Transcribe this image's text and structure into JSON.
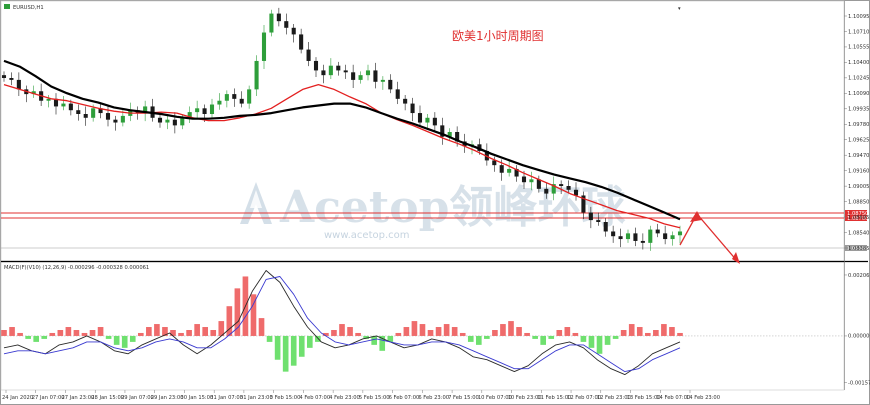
{
  "window": {
    "title": "EURUSD,H1"
  },
  "annotation": {
    "text": "欧美1小时周期图",
    "color": "#e03030"
  },
  "watermark": {
    "brand": "Acetop领峰环球",
    "url": "www.acetop.com",
    "color": "#b8c9d8"
  },
  "indicator_header": "MACD(F)(V10) (12,26,9) -0.000296 -0.000328 0.000061",
  "colors": {
    "bull": "#2e9e3a",
    "bear": "#1a1a1a",
    "ma_fast": "#e32020",
    "ma_slow": "#000000",
    "hist_pos": "#ef6b6b",
    "hist_neg": "#6fe06f",
    "macd_line": "#2a2a2a",
    "signal_line": "#3a3ad0",
    "level_line": "#e03030",
    "grid_sep": "#000000"
  },
  "chart_data": [
    {
      "type": "line",
      "name": "price-panel",
      "title": "EURUSD,H1",
      "y_ticks": [
        "1.10095",
        "1.10710",
        "1.10555",
        "1.10400",
        "1.10245",
        "1.10090",
        "1.09935",
        "1.09780",
        "1.09625",
        "1.09470",
        "1.09160",
        "1.09005",
        "1.08850",
        "1.08695",
        "1.08540",
        "1.08385"
      ],
      "ylim": [
        1.0832,
        1.1098
      ],
      "levels": [
        {
          "price": 1.0875,
          "label": "1.08750"
        },
        {
          "price": 1.0866,
          "label": "1.08700"
        },
        {
          "price": 1.0838,
          "label": "1.08385"
        }
      ],
      "series": [
        {
          "name": "",
          "values": [
            1.1015,
            1.101,
            1.1005,
            1.1,
            1.0998,
            1.0994,
            1.099,
            1.0987,
            1.0985,
            1.0985,
            1.0986,
            1.0985,
            1.098,
            1.0977,
            1.0977,
            1.098,
            1.0984,
            1.099,
            1.1,
            1.101,
            1.1015,
            1.101,
            1.1002,
            1.0995,
            1.0985,
            1.0978,
            1.0972,
            1.0965,
            1.0958,
            1.0952,
            1.0945,
            1.0937,
            1.093,
            1.0922,
            1.0915,
            1.0908,
            1.09,
            1.0894,
            1.0888,
            1.0882,
            1.0878,
            1.0874,
            1.0868,
            1.0864
          ]
        },
        {
          "name": "",
          "values": [
            1.104,
            1.1034,
            1.1024,
            1.1013,
            1.1006,
            1.1,
            1.0996,
            1.0991,
            1.0988,
            1.0986,
            1.0984,
            1.0981,
            1.0979,
            1.0979,
            1.098,
            1.0982,
            1.0983,
            1.0985,
            1.0988,
            1.0991,
            1.0993,
            1.0995,
            1.0995,
            1.0991,
            1.0985,
            1.0979,
            1.0974,
            1.0968,
            1.0962,
            1.0955,
            1.0949,
            1.0942,
            1.0936,
            1.093,
            1.0925,
            1.092,
            1.0916,
            1.0912,
            1.0907,
            1.0901,
            1.0894,
            1.0887,
            1.088,
            1.0873
          ]
        }
      ],
      "candles": [
        1.1022,
        1.102,
        1.101,
        1.1005,
        1.1008,
        1.0998,
        1.1,
        1.0992,
        1.0995,
        1.0988,
        1.0984,
        1.098,
        1.099,
        1.0985,
        1.0978,
        1.0975,
        1.0982,
        1.0988,
        1.0985,
        1.0992,
        1.098,
        1.0975,
        1.0978,
        1.0972,
        1.098,
        1.0986,
        1.099,
        1.0984,
        1.0994,
        1.0998,
        1.1005,
        1.1,
        1.0995,
        1.101,
        1.104,
        1.107,
        1.109,
        1.1082,
        1.1075,
        1.1068,
        1.1052,
        1.104,
        1.103,
        1.1025,
        1.1035,
        1.103,
        1.1028,
        1.102,
        1.1025,
        1.103,
        1.1018,
        1.102,
        1.101,
        1.1,
        1.0995,
        1.0985,
        1.0975,
        1.098,
        1.0972,
        1.096,
        1.0965,
        1.0955,
        1.095,
        1.0952,
        1.0945,
        1.0935,
        1.093,
        1.0922,
        1.0926,
        1.0918,
        1.0912,
        1.0915,
        1.0905,
        1.09,
        1.091,
        1.0908,
        1.0904,
        1.0898,
        1.088,
        1.0872,
        1.087,
        1.086,
        1.0855,
        1.0852,
        1.0858,
        1.085,
        1.0848,
        1.0862,
        1.0858,
        1.0852,
        1.0856,
        1.086
      ]
    },
    {
      "type": "bar",
      "name": "macd-panel",
      "y_ticks": [
        "0.002067",
        "0.000000",
        "-0.001572"
      ],
      "ylim": [
        -0.00175,
        0.00215
      ],
      "histogram": [
        0.0002,
        0.0003,
        0.0001,
        -0.0001,
        -0.0002,
        -0.0001,
        0.0001,
        0.0002,
        0.0003,
        0.0002,
        0.0001,
        0.0002,
        0.0003,
        -0.0001,
        -0.0003,
        -0.0004,
        -0.0002,
        0.0001,
        0.0003,
        0.0004,
        0.0003,
        0.0002,
        0.0001,
        0.0002,
        0.0004,
        0.0003,
        0.0002,
        0.0005,
        0.001,
        0.0016,
        0.002,
        0.0014,
        0.0006,
        -0.0002,
        -0.0008,
        -0.0012,
        -0.001,
        -0.0007,
        -0.0004,
        -0.0002,
        0.0001,
        0.0002,
        0.0004,
        0.0003,
        0.0001,
        -0.0001,
        -0.0003,
        -0.0005,
        -0.0002,
        0.0001,
        0.0003,
        0.0005,
        0.0004,
        0.0002,
        0.0003,
        0.0004,
        0.0003,
        0.0001,
        -0.0002,
        -0.0003,
        -0.0001,
        0.0002,
        0.0004,
        0.0005,
        0.0003,
        0.0001,
        -0.0001,
        -0.0003,
        -0.0001,
        0.0002,
        0.0003,
        0.0001,
        -0.0002,
        -0.0004,
        -0.0006,
        -0.0003,
        -0.0001,
        0.0002,
        0.0004,
        0.0003,
        0.0001,
        0.0002,
        0.0004,
        0.0003,
        0.0001
      ],
      "series": [
        {
          "name": "",
          "values": [
            -0.0004,
            -0.0003,
            -0.0005,
            -0.0006,
            -0.0003,
            -0.0002,
            0.0,
            -0.0002,
            -0.0005,
            -0.0006,
            -0.0003,
            -0.0001,
            0.0001,
            -0.0003,
            -0.0006,
            -0.0003,
            0.0001,
            0.0005,
            0.0015,
            0.0022,
            0.0018,
            0.001,
            0.0003,
            -0.0002,
            -0.0004,
            -0.0003,
            -0.0001,
            0.0,
            -0.0002,
            -0.0004,
            -0.0003,
            -0.0001,
            -0.0002,
            -0.0004,
            -0.0007,
            -0.0008,
            -0.001,
            -0.0012,
            -0.001,
            -0.0006,
            -0.0003,
            -0.0002,
            -0.0004,
            -0.0008,
            -0.0011,
            -0.0013,
            -0.001,
            -0.0006,
            -0.0004,
            -0.0002
          ]
        },
        {
          "name": "",
          "values": [
            -0.0006,
            -0.0005,
            -0.0005,
            -0.0006,
            -0.0005,
            -0.0004,
            -0.0002,
            -0.0002,
            -0.0004,
            -0.0005,
            -0.0004,
            -0.0002,
            -0.0001,
            -0.0002,
            -0.0004,
            -0.0004,
            -0.0001,
            0.0003,
            0.001,
            0.0019,
            0.002,
            0.0014,
            0.0006,
            0.0001,
            -0.0002,
            -0.0003,
            -0.0002,
            -0.0001,
            -0.0002,
            -0.0003,
            -0.0003,
            -0.0002,
            -0.0002,
            -0.0003,
            -0.0005,
            -0.0007,
            -0.0009,
            -0.0011,
            -0.0011,
            -0.0008,
            -0.0005,
            -0.0003,
            -0.0003,
            -0.0006,
            -0.0009,
            -0.0012,
            -0.0011,
            -0.0008,
            -0.0006,
            -0.0004
          ]
        }
      ]
    }
  ],
  "x_ticks": [
    "24 Jan 2020",
    "27 Jan 07:00",
    "27 Jan 23:00",
    "28 Jan 15:00",
    "29 Jan 07:00",
    "29 Jan 23:00",
    "30 Jan 15:00",
    "31 Jan 07:00",
    "31 Jan 23:00",
    "3 Feb 15:00",
    "4 Feb 07:00",
    "4 Feb 23:00",
    "5 Feb 15:00",
    "6 Feb 07:00",
    "6 Feb 23:00",
    "7 Feb 15:00",
    "10 Feb 07:00",
    "10 Feb 23:00",
    "11 Feb 15:00",
    "12 Feb 07:00",
    "12 Feb 23:00",
    "13 Feb 15:00",
    "14 Feb 07:00",
    "14 Feb 23:00"
  ]
}
